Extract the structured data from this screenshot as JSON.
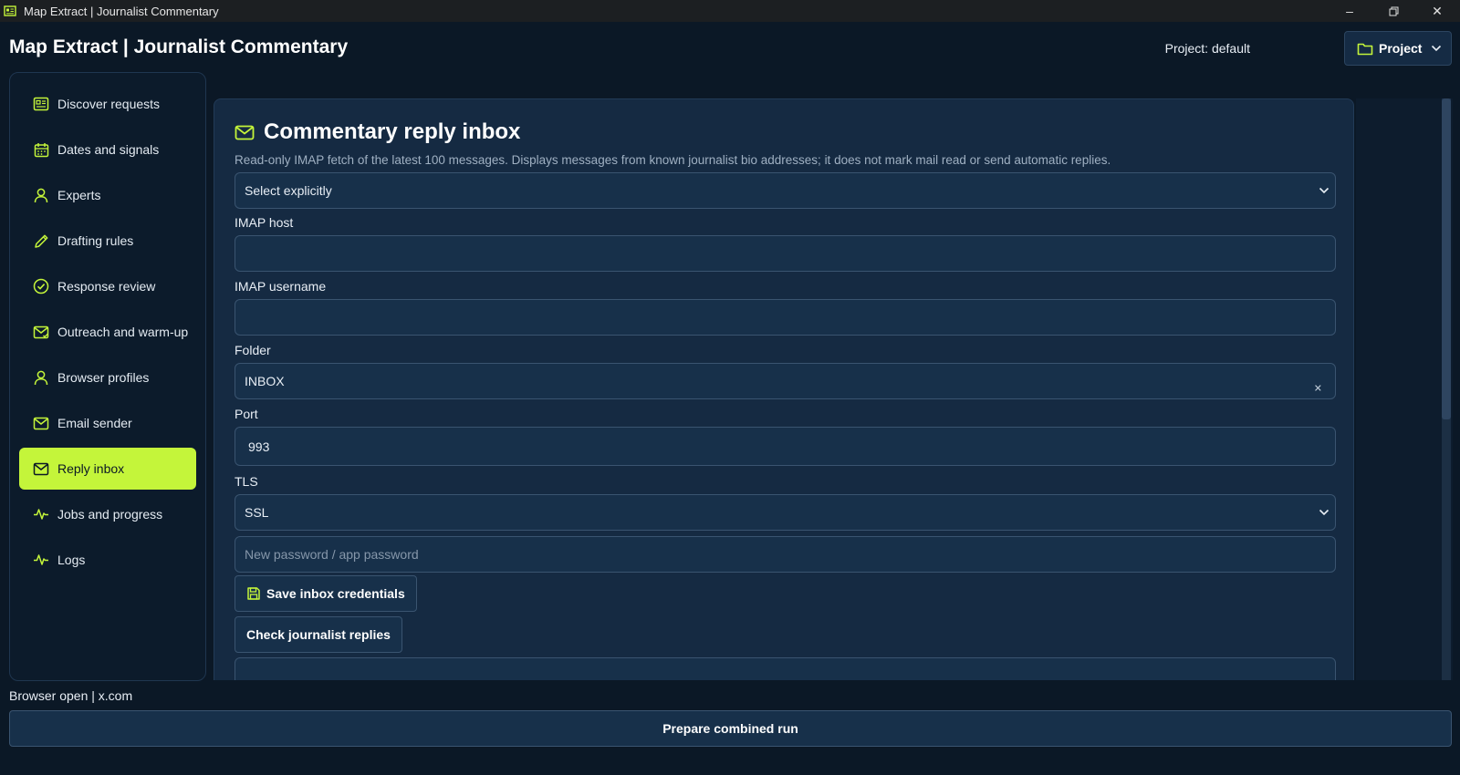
{
  "window": {
    "title": "Map Extract | Journalist Commentary"
  },
  "header": {
    "title": "Map Extract | Journalist Commentary",
    "project_label": "Project: default",
    "project_button": "Project",
    "icons": {
      "project": "folder-icon",
      "menu": "chevron-down-icon"
    }
  },
  "sidebar": {
    "items": [
      {
        "label": "Discover requests",
        "icon": "newspaper-icon",
        "active": false
      },
      {
        "label": "Dates and signals",
        "icon": "calendar-icon",
        "active": false
      },
      {
        "label": "Experts",
        "icon": "user-icon",
        "active": false
      },
      {
        "label": "Drafting rules",
        "icon": "pencil-icon",
        "active": false
      },
      {
        "label": "Response review",
        "icon": "check-circle-icon",
        "active": false
      },
      {
        "label": "Outreach and warm-up",
        "icon": "mail-check-icon",
        "active": false
      },
      {
        "label": "Browser profiles",
        "icon": "user-icon",
        "active": false
      },
      {
        "label": "Email sender",
        "icon": "mail-icon",
        "active": false
      },
      {
        "label": "Reply inbox",
        "icon": "mail-icon",
        "active": true
      },
      {
        "label": "Jobs and progress",
        "icon": "activity-icon",
        "active": false
      },
      {
        "label": "Logs",
        "icon": "activity-icon",
        "active": false
      }
    ]
  },
  "panel": {
    "title": "Commentary reply inbox",
    "description": "Read-only IMAP fetch of the latest 100 messages. Displays messages from known journalist bio addresses; it does not mark mail read or send automatic replies.",
    "account_select": "Select explicitly",
    "imap_host": {
      "label": "IMAP host",
      "value": ""
    },
    "imap_username": {
      "label": "IMAP username",
      "value": ""
    },
    "folder": {
      "label": "Folder",
      "value": "INBOX"
    },
    "port": {
      "label": "Port",
      "value": "993"
    },
    "tls": {
      "label": "TLS",
      "value": "SSL"
    },
    "password": {
      "placeholder": "New password / app password"
    },
    "save_button": "Save inbox credentials",
    "check_button": "Check journalist replies"
  },
  "footer": {
    "status": "Browser open | x.com",
    "run_button": "Prepare combined run"
  },
  "colors": {
    "accent": "#c4f53a",
    "background": "#0b1826",
    "panel": "#152a42"
  }
}
